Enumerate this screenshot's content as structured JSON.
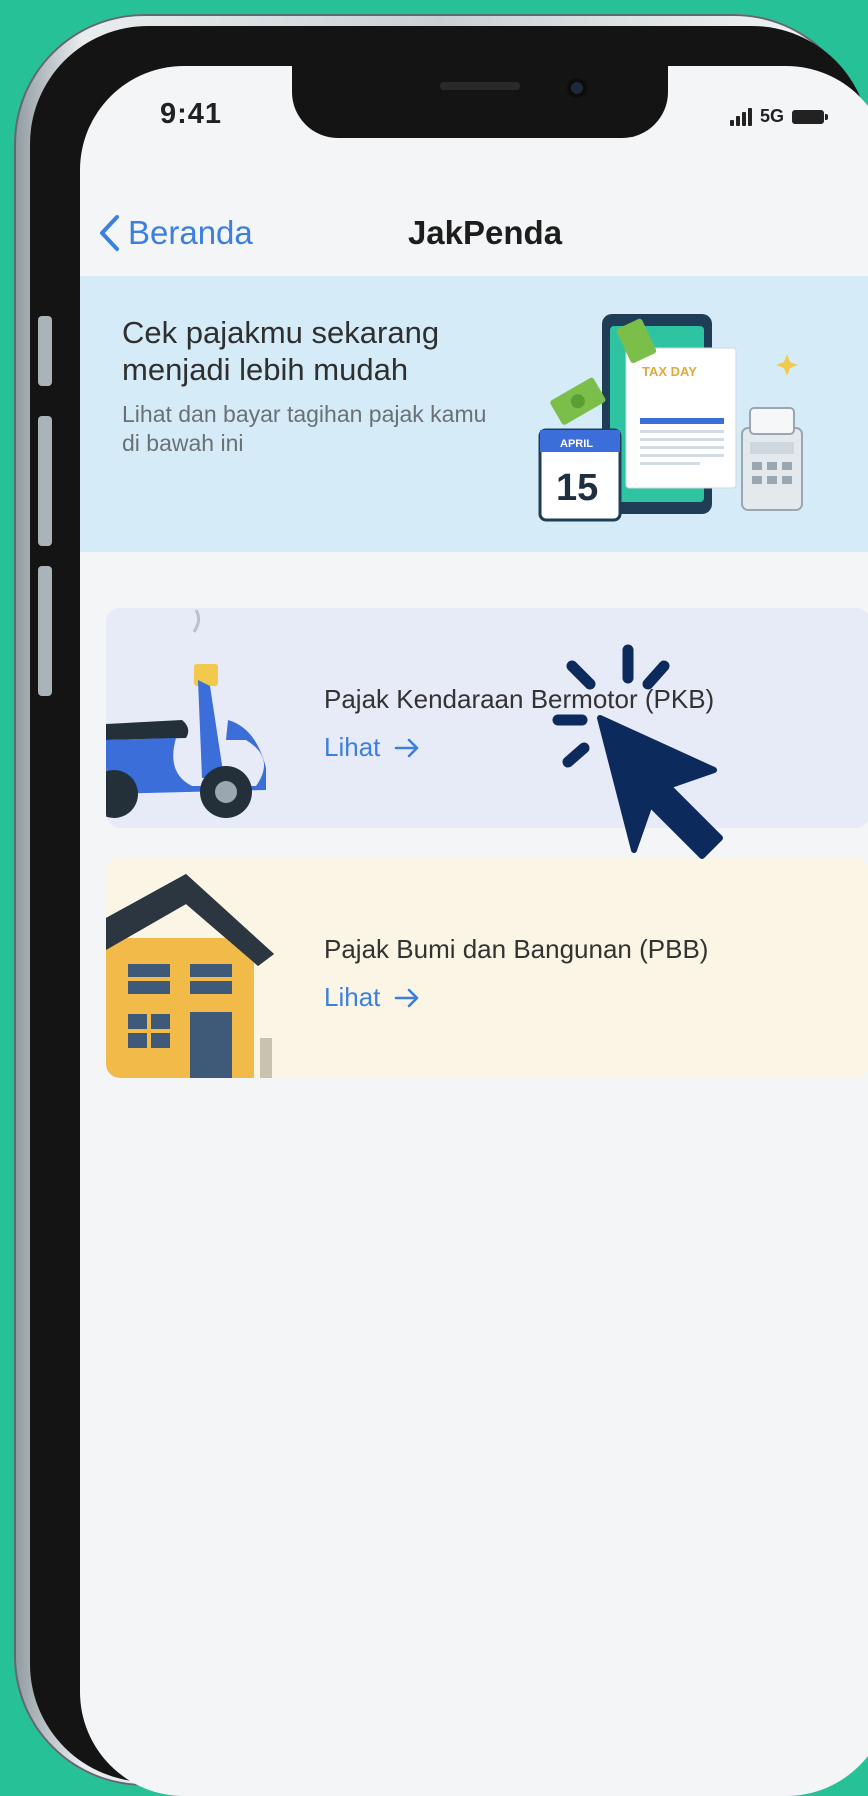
{
  "status_bar": {
    "time": "9:41",
    "network": "5G"
  },
  "nav": {
    "back_label": "Beranda",
    "title": "JakPenda"
  },
  "banner": {
    "title": "Cek pajakmu sekarang menjadi lebih mudah",
    "subtitle": "Lihat dan bayar tagihan pajak kamu di bawah ini",
    "art": {
      "calendar_month": "APRIL",
      "calendar_day": "15",
      "document_heading": "TAX DAY"
    }
  },
  "tax_cards": [
    {
      "title": "Pajak Kendaraan Bermotor (PKB)",
      "link_label": "Lihat",
      "icon": "scooter-icon"
    },
    {
      "title": "Pajak Bumi dan Bangunan (PBB)",
      "link_label": "Lihat",
      "icon": "house-icon"
    }
  ],
  "colors": {
    "background": "#27c197",
    "accent": "#3c7fe0",
    "banner_bg": "#d5ecf8",
    "pkb_card_bg": "#e7ebf8",
    "pbb_card_bg": "#faf5e4",
    "cursor": "#0d2a5c"
  }
}
